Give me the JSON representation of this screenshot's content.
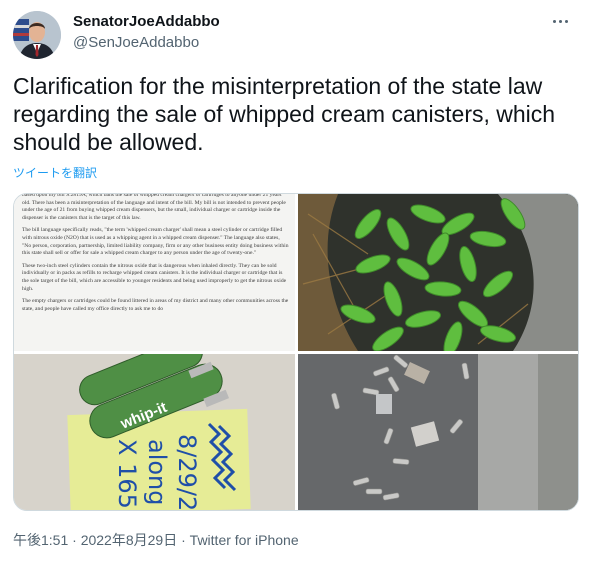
{
  "author": {
    "display_name": "SenatorJoeAddabbo",
    "handle": "@SenJoeAddabbo"
  },
  "tweet": {
    "text": "Clarification for the misinterpretation of the state law regarding the sale of whipped cream canisters, which should be allowed.",
    "translate_label": "ツイートを翻訳"
  },
  "media": {
    "document_paragraphs": [
      "based upon my bill S.2819A, which bans the sale of whipped cream chargers or cartridges to anyone under 21 years old. There has been a misinterpretation of the language and intent of the bill. My bill is not intended to prevent people under the age of 21 from buying whipped cream dispensers, but the small, individual charger or cartridge inside the dispenser is the canisters that is the target of this law.",
      "The bill language specifically reads, \"the term 'whipped cream charger' shall mean a steel cylinder or cartridge filled with nitrous oxide (N2O) that is used as a whipping agent in a whipped cream dispenser.\" The language also states, \"No person, corporation, partnership, limited liability company, firm or any other business entity doing business within this state shall sell or offer for sale a whipped cream charger to any person under the age of twenty-one.\"",
      "These two-inch steel cylinders contain the nitrous oxide that is dangerous when inhaled directly. They can be sold individually or in packs as refills to recharge whipped cream canisters. It is the individual charger or cartridge that is the sole target of the bill, which are accessible to younger residents and being used improperly to get the nitrous oxide high.",
      "The empty chargers or cartridges could be found littered in areas of my district and many other communities across the state, and people have called my office directly to ask me to do"
    ],
    "charger_label": "whip-it",
    "note_lines": [
      "8/29/22",
      "along",
      "X 165"
    ],
    "note_colors": {
      "paper": "#e6ec96",
      "ink": "#1f4fa8"
    },
    "charger_color": "#4f8f45"
  },
  "footer": {
    "time": "午後1:51",
    "separator": "·",
    "date": "2022年8月29日",
    "source": "Twitter for iPhone"
  },
  "colors": {
    "text_primary": "#0f1419",
    "text_secondary": "#536471",
    "link": "#1d9bf0",
    "border": "#cfd9de"
  }
}
